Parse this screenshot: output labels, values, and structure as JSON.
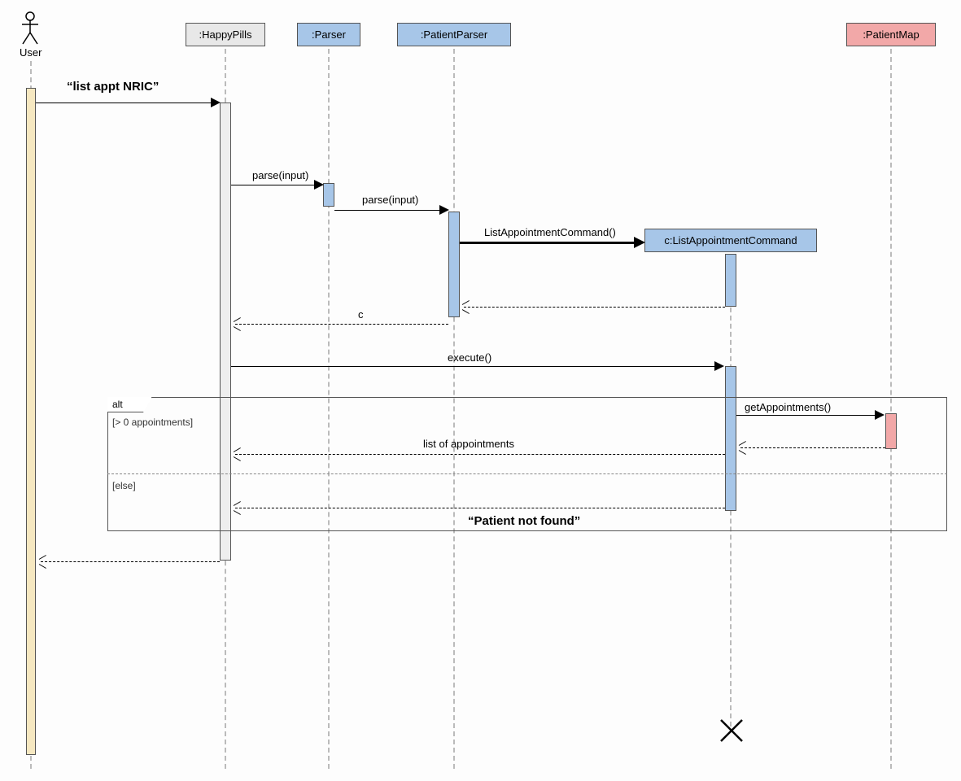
{
  "actors": {
    "user_label": "User"
  },
  "heads": {
    "happypills": ":HappyPills",
    "parser": ":Parser",
    "patientparser": ":PatientParser",
    "patientmap": ":PatientMap",
    "listcmd": "c:ListAppointmentCommand"
  },
  "messages": {
    "list_appt": "“list appt NRIC”",
    "parse1": "parse(input)",
    "parse2": "parse(input)",
    "listcmd_ctor": "ListAppointmentCommand()",
    "return_c": "c",
    "execute": "execute()",
    "get_appts": "getAppointments()",
    "list_of_appts": "list of appointments",
    "not_found": "“Patient not found”"
  },
  "fragment": {
    "alt_label": "alt",
    "guard1": "[> 0 appointments]",
    "guard2": "[else]"
  }
}
